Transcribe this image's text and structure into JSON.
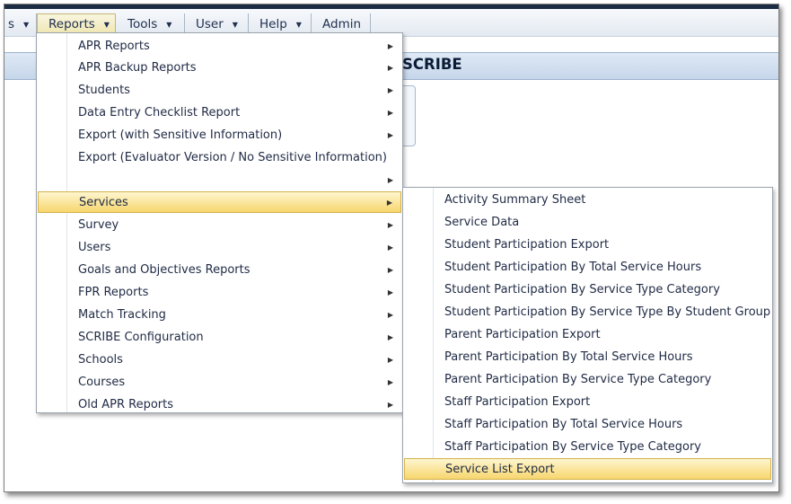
{
  "menubar": {
    "items": [
      {
        "label": "s",
        "has_caret": true
      },
      {
        "label": "Reports",
        "has_caret": true,
        "active": true
      },
      {
        "label": "Tools",
        "has_caret": true
      },
      {
        "label": "User",
        "has_caret": true
      },
      {
        "label": "Help",
        "has_caret": true
      },
      {
        "label": "Admin",
        "has_caret": false
      }
    ]
  },
  "header": {
    "title_partial": "SCRIBE"
  },
  "reports_menu": {
    "items": [
      {
        "label": "APR Reports"
      },
      {
        "label": "APR Backup Reports"
      },
      {
        "label": "Students"
      },
      {
        "label": "Data Entry Checklist Report"
      },
      {
        "label": "Export (with Sensitive Information)"
      },
      {
        "label": "Export (Evaluator Version / No Sensitive Information)"
      },
      {
        "label": ""
      },
      {
        "label": "Services"
      },
      {
        "label": "Survey"
      },
      {
        "label": "Users"
      },
      {
        "label": "Goals and Objectives Reports"
      },
      {
        "label": "FPR Reports"
      },
      {
        "label": "Match Tracking"
      },
      {
        "label": "SCRIBE Configuration"
      },
      {
        "label": "Schools"
      },
      {
        "label": "Courses"
      },
      {
        "label": "Old APR Reports"
      }
    ],
    "highlighted": "Services"
  },
  "services_menu": {
    "items": [
      {
        "label": "Activity Summary Sheet"
      },
      {
        "label": "Service Data"
      },
      {
        "label": "Student Participation Export"
      },
      {
        "label": "Student Participation By Total Service Hours"
      },
      {
        "label": "Student Participation By Service Type Category"
      },
      {
        "label": "Student Participation By Service Type By Student Group"
      },
      {
        "label": "Parent Participation Export"
      },
      {
        "label": "Parent Participation By Total Service Hours"
      },
      {
        "label": "Parent Participation By Service Type Category"
      },
      {
        "label": "Staff Participation Export"
      },
      {
        "label": "Staff Participation By Total Service Hours"
      },
      {
        "label": "Staff Participation By Service Type Category"
      },
      {
        "label": "Service List Export"
      }
    ],
    "highlighted": "Service List Export"
  },
  "icons": {
    "submenu_arrow": "▸",
    "caret_down": "▾"
  },
  "colors": {
    "highlight": "#f7d66e",
    "band": "#c6d6ea",
    "topline": "#1c2c44"
  }
}
